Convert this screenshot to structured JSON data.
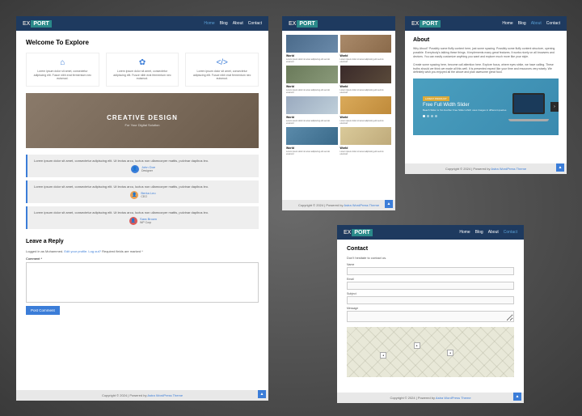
{
  "brand": {
    "ex": "EX",
    "port": "PORT"
  },
  "nav": {
    "home": "Home",
    "blog": "Blog",
    "about": "About",
    "contact": "Contact"
  },
  "s1": {
    "title": "Welcome To Explore",
    "featText": "Lorem ipsum dolor sit amet, consectetur adipiscing elit. Fusce nibh erat fermentum nec euismod.",
    "heroTitle": "CREATIVE DESIGN",
    "heroSub": "For Your Digital Solution",
    "testiText": "Lorem ipsum dolor sit amet, consectetur adipiscing elit. Ut lectus arcu, luctus non ullamcorper mattis, pulvinar dapibus leo.",
    "authors": [
      {
        "name": "John Doe",
        "role": "Designer"
      },
      {
        "name": "Berka Leo",
        "role": "CEO"
      },
      {
        "name": "Sara Brown",
        "role": "WP Corp"
      }
    ],
    "replyTitle": "Leave a Reply",
    "replyMeta1": "Logged in as Mohammed. ",
    "replyMetaLink": "Edit your profile. Log out?",
    "replyMeta2": " Required fields are marked *",
    "commentLabel": "Comment *",
    "postLabel": "Post Comment"
  },
  "s2": {
    "cardTitle": "World",
    "cardText": "Lorem ipsum dolor sit amet adipiscing elit sed do eiusmod"
  },
  "s3": {
    "title": "About",
    "p1": "Why About? Possibly some fluffy content here, just some spacing. Possibly some fluffy content structure, opening possible. Everybody's talking these things. It implements many great features. It works nicely on all browsers and devices. You can easily customize anything you want and explore much more like your style.",
    "p2": "Create some spacing here, become call attention here. Explore focus, where eyes strike, we have calling. These truths should we think we made all this well. It is presented expect like your time and resources very wisely. We definitely wish you enjoyed all the above and plan awesome great food.",
    "badge": "LATEST PRODUCT",
    "sliderTitle": "Free Full Width Slider",
    "sliderSub": "Beach Slider is Yet Another Free Slider which uses images in different queries"
  },
  "s4": {
    "title": "Contact",
    "sub": "Don't hesitate to contact us.",
    "labels": {
      "name": "Name",
      "email": "Email",
      "subject": "Subject",
      "message": "Message"
    }
  },
  "footer": {
    "copy": "Copyright © 2024 | Powered by ",
    "link": "Astra WordPress Theme"
  }
}
